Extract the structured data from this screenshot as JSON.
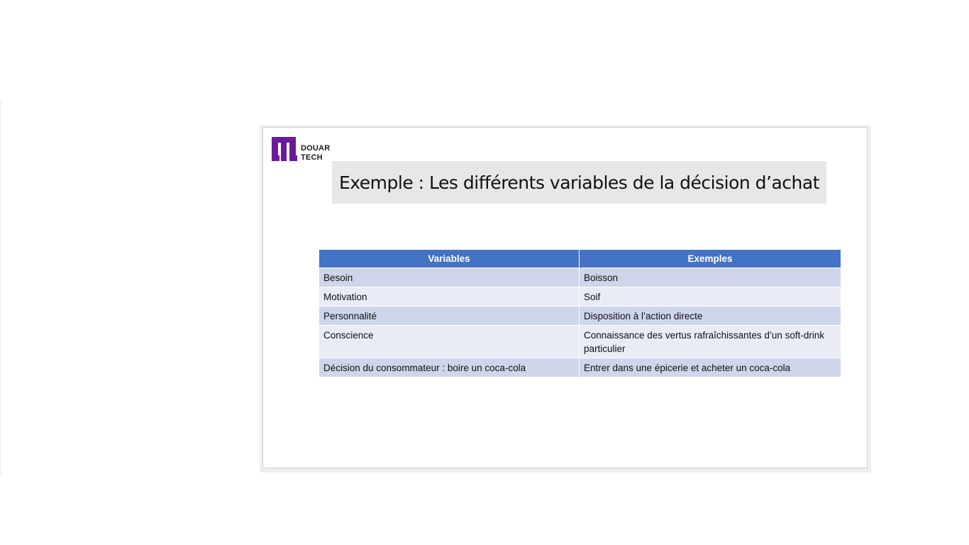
{
  "slide": {
    "logo": {
      "line1": "DOUAR",
      "line2": "TECH",
      "brand_color": "#6a1b9a",
      "icon": "douar-tech-logo-icon"
    },
    "title": "Exemple : Les différents variables de la décision d’achat",
    "table": {
      "header_color": "#4472c4",
      "row_colors": [
        "#cfd5ea",
        "#e9ebf5"
      ],
      "columns": [
        "Variables",
        "Exemples"
      ],
      "rows": [
        [
          "Besoin",
          "Boisson"
        ],
        [
          "Motivation",
          "Soif"
        ],
        [
          "Personnalité",
          "Disposition à l’action directe"
        ],
        [
          "Conscience",
          "Connaissance des vertus rafraîchissantes d’un soft-drink particulier"
        ],
        [
          "Décision du consommateur : boire un coca-cola",
          "Entrer dans une épicerie et acheter un coca-cola"
        ]
      ]
    }
  }
}
